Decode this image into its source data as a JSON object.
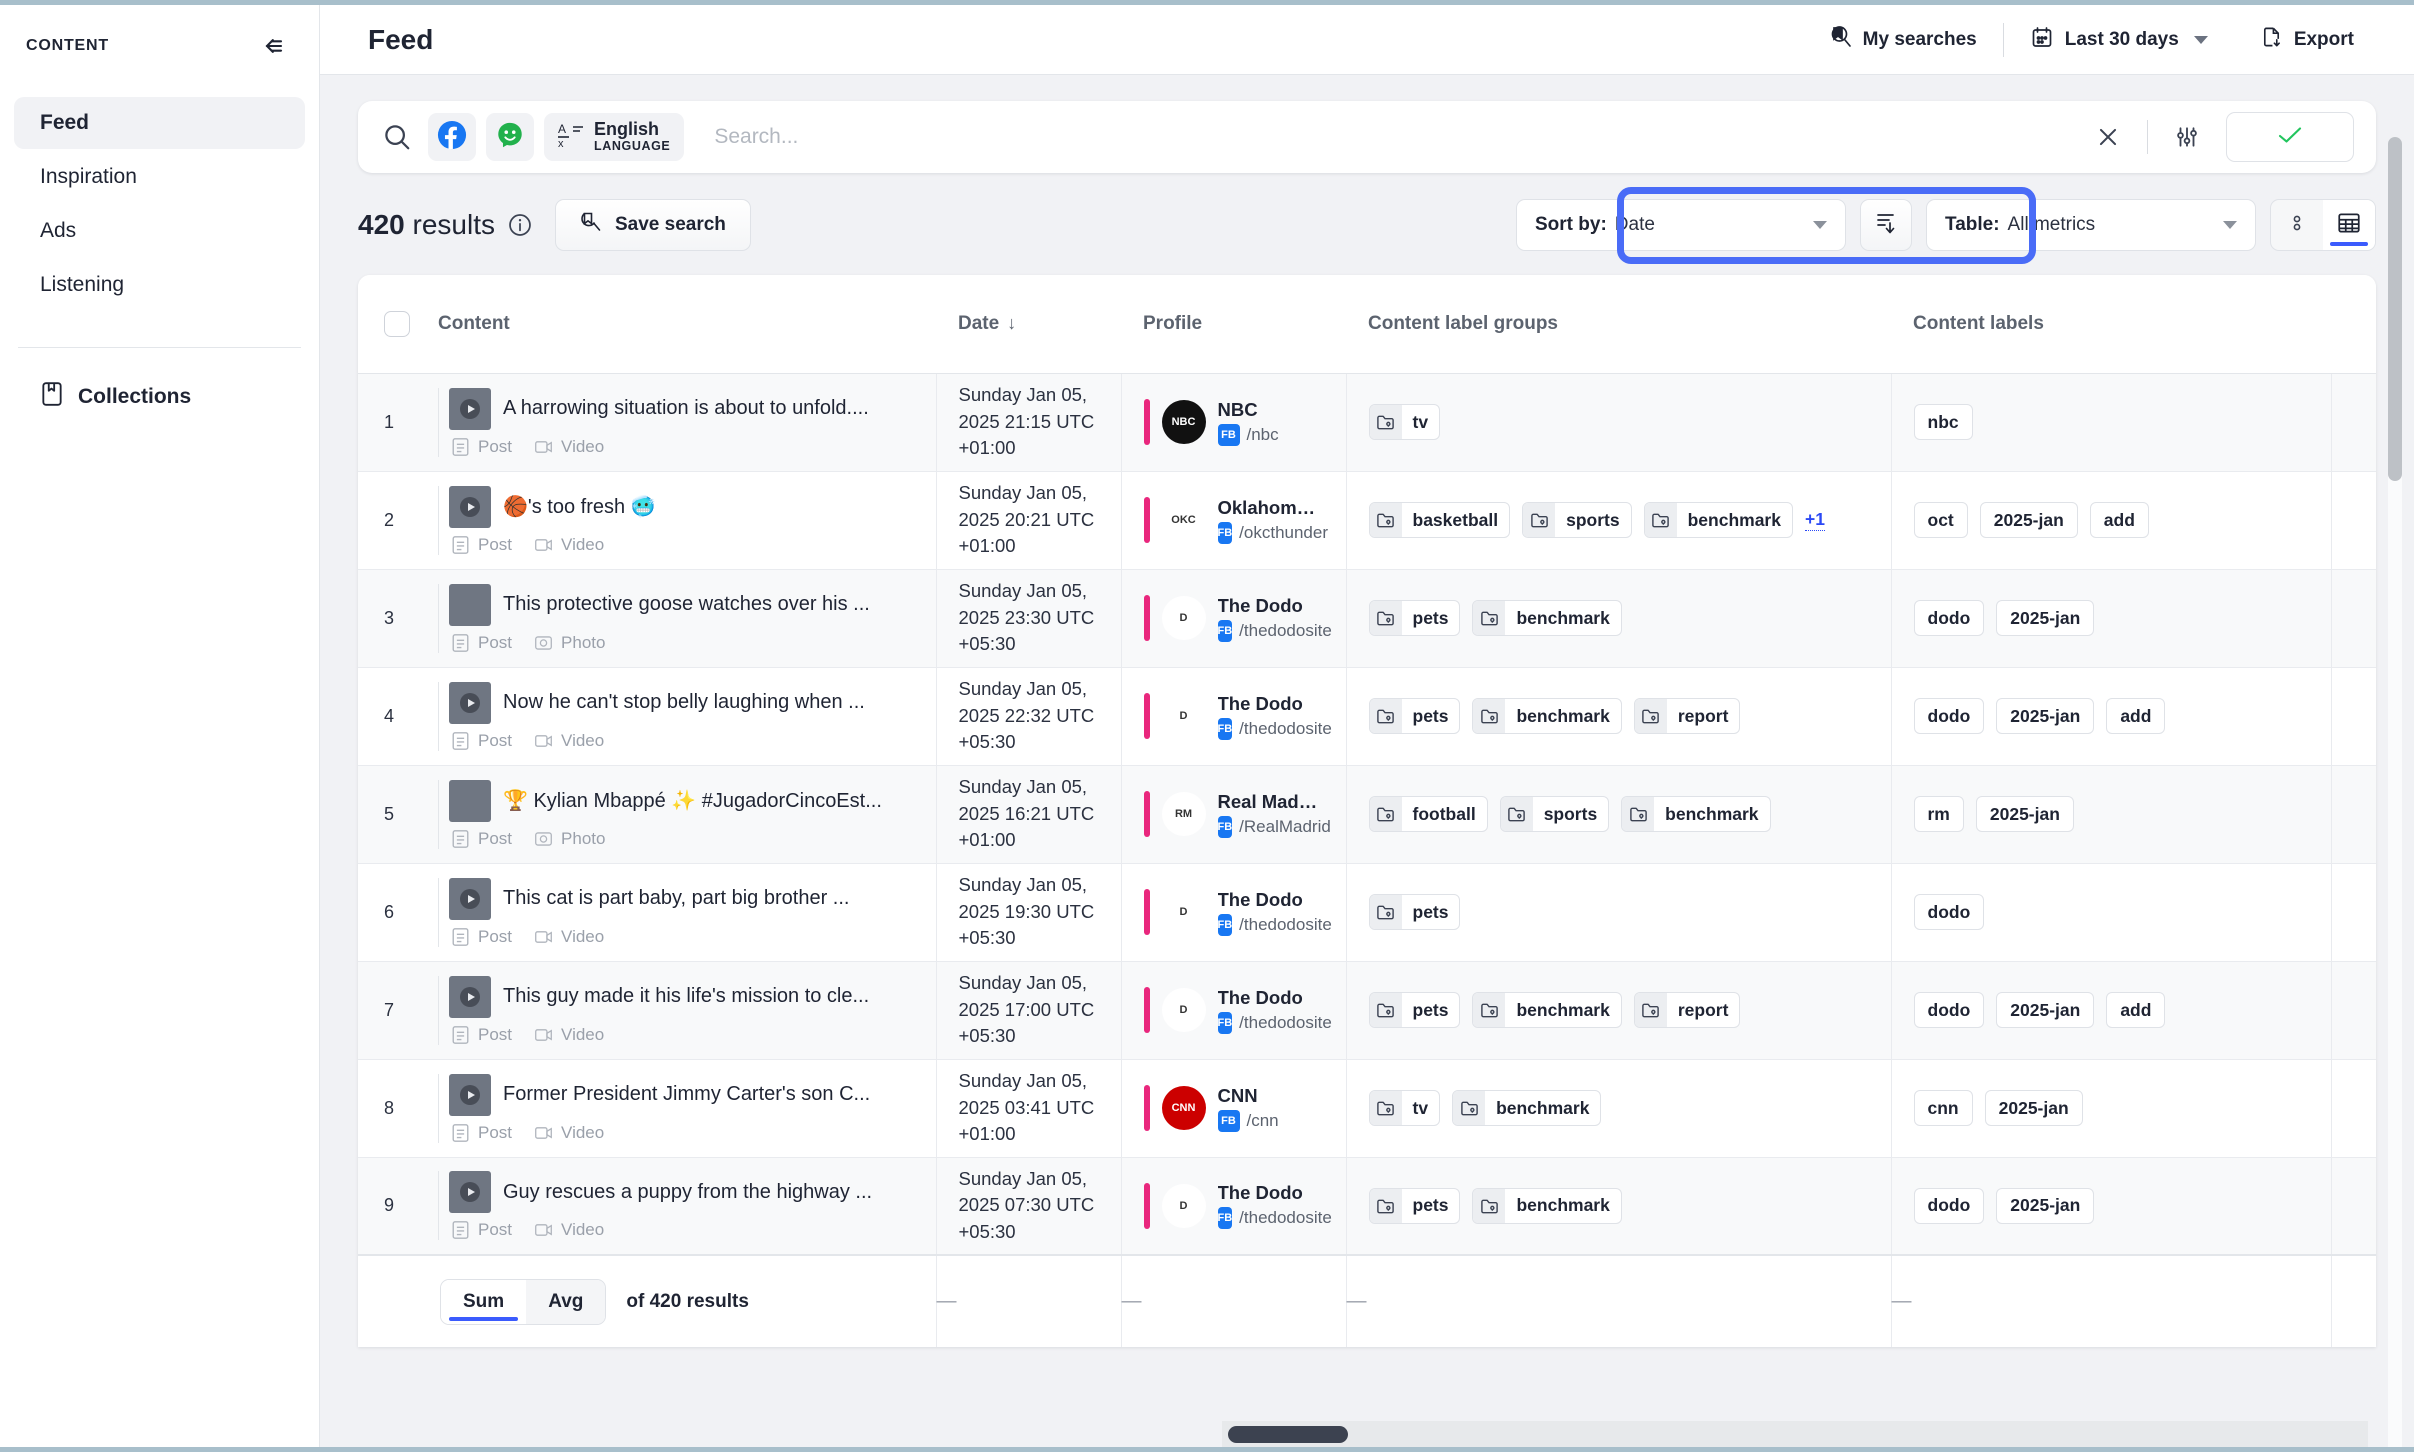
{
  "sidebar": {
    "title": "CONTENT",
    "collapse_icon": "collapse-panel-icon",
    "items": [
      {
        "label": "Feed",
        "active": true
      },
      {
        "label": "Inspiration",
        "active": false
      },
      {
        "label": "Ads",
        "active": false
      },
      {
        "label": "Listening",
        "active": false
      }
    ],
    "collections": {
      "label": "Collections",
      "icon": "bookmark-book-icon"
    }
  },
  "header": {
    "title": "Feed",
    "my_searches": "My searches",
    "date_range": "Last 30 days",
    "export": "Export"
  },
  "search": {
    "placeholder": "Search...",
    "value": "",
    "network_chip": "facebook-icon",
    "sentiment_chip": "sentiment-smiley-icon",
    "language_name": "English",
    "language_sub": "LANGUAGE",
    "clear_icon": "close-icon",
    "filters_icon": "sliders-icon",
    "submit_icon": "check-icon",
    "submit_color": "#22c55e"
  },
  "results": {
    "count": "420",
    "count_suffix": " results",
    "info_icon": "info-icon",
    "save_search": "Save search",
    "sort_label": "Sort by:",
    "sort_value": "Date",
    "sort_direction_icon": "sort-descending-icon",
    "table_label": "Table:",
    "table_value": "All metrics",
    "more_icon": "more-options-icon",
    "table_view_icon": "table-view-icon",
    "accent": "#3b5bfd"
  },
  "table": {
    "columns": [
      "Content",
      "Date",
      "Profile",
      "Content label groups",
      "Content labels"
    ],
    "sorted_column": "Date",
    "sort_arrow": "↓",
    "rows": [
      {
        "index": "1",
        "text": "A harrowing situation is about to unfold....",
        "kind": "Post",
        "media": "Video",
        "date": "Sunday Jan 05, 2025 21:15 UTC +01:00",
        "profile_name": "NBC",
        "profile_handle": "/nbc",
        "network": "FB",
        "avatar_color": "#111111",
        "avatar_text": "NBC",
        "label_groups": [
          "tv"
        ],
        "extra_groups": "",
        "labels": [
          "nbc"
        ]
      },
      {
        "index": "2",
        "text": "🏀's too fresh 🥶",
        "kind": "Post",
        "media": "Video",
        "date": "Sunday Jan 05, 2025 20:21 UTC +01:00",
        "profile_name": "Oklahoma City Th...",
        "profile_handle": "/okcthunder",
        "network": "FB",
        "avatar_color": "#ffffff",
        "avatar_text": "OKC",
        "label_groups": [
          "basketball",
          "sports",
          "benchmark"
        ],
        "extra_groups": "+1",
        "labels": [
          "oct",
          "2025-jan",
          "add"
        ]
      },
      {
        "index": "3",
        "text": "This protective goose watches over his ...",
        "kind": "Post",
        "media": "Photo",
        "date": "Sunday Jan 05, 2025 23:30 UTC +05:30",
        "profile_name": "The Dodo",
        "profile_handle": "/thedodosite",
        "network": "FB",
        "avatar_color": "#ffffff",
        "avatar_text": "D",
        "label_groups": [
          "pets",
          "benchmark"
        ],
        "extra_groups": "",
        "labels": [
          "dodo",
          "2025-jan"
        ]
      },
      {
        "index": "4",
        "text": "Now he can't stop belly laughing when ...",
        "kind": "Post",
        "media": "Video",
        "date": "Sunday Jan 05, 2025 22:32 UTC +05:30",
        "profile_name": "The Dodo",
        "profile_handle": "/thedodosite",
        "network": "FB",
        "avatar_color": "#ffffff",
        "avatar_text": "D",
        "label_groups": [
          "pets",
          "benchmark",
          "report"
        ],
        "extra_groups": "",
        "labels": [
          "dodo",
          "2025-jan",
          "add"
        ]
      },
      {
        "index": "5",
        "text": "🏆 Kylian Mbappé ✨ #JugadorCincoEst...",
        "kind": "Post",
        "media": "Photo",
        "date": "Sunday Jan 05, 2025 16:21 UTC +01:00",
        "profile_name": "Real Madrid C.F.",
        "profile_handle": "/RealMadrid",
        "network": "FB",
        "avatar_color": "#ffffff",
        "avatar_text": "RM",
        "label_groups": [
          "football",
          "sports",
          "benchmark"
        ],
        "extra_groups": "",
        "labels": [
          "rm",
          "2025-jan"
        ]
      },
      {
        "index": "6",
        "text": "This cat is part baby, part big brother ...",
        "kind": "Post",
        "media": "Video",
        "date": "Sunday Jan 05, 2025 19:30 UTC +05:30",
        "profile_name": "The Dodo",
        "profile_handle": "/thedodosite",
        "network": "FB",
        "avatar_color": "#ffffff",
        "avatar_text": "D",
        "label_groups": [
          "pets"
        ],
        "extra_groups": "",
        "labels": [
          "dodo"
        ]
      },
      {
        "index": "7",
        "text": "This guy made it his life's mission to cle...",
        "kind": "Post",
        "media": "Video",
        "date": "Sunday Jan 05, 2025 17:00 UTC +05:30",
        "profile_name": "The Dodo",
        "profile_handle": "/thedodosite",
        "network": "FB",
        "avatar_color": "#ffffff",
        "avatar_text": "D",
        "label_groups": [
          "pets",
          "benchmark",
          "report"
        ],
        "extra_groups": "",
        "labels": [
          "dodo",
          "2025-jan",
          "add"
        ]
      },
      {
        "index": "8",
        "text": "Former President Jimmy Carter's son C...",
        "kind": "Post",
        "media": "Video",
        "date": "Sunday Jan 05, 2025 03:41 UTC +01:00",
        "profile_name": "CNN",
        "profile_handle": "/cnn",
        "network": "FB",
        "avatar_color": "#cc0000",
        "avatar_text": "CNN",
        "label_groups": [
          "tv",
          "benchmark"
        ],
        "extra_groups": "",
        "labels": [
          "cnn",
          "2025-jan"
        ]
      },
      {
        "index": "9",
        "text": "Guy rescues a puppy from the highway ...",
        "kind": "Post",
        "media": "Video",
        "date": "Sunday Jan 05, 2025 07:30 UTC +05:30",
        "profile_name": "The Dodo",
        "profile_handle": "/thedodosite",
        "network": "FB",
        "avatar_color": "#ffffff",
        "avatar_text": "D",
        "label_groups": [
          "pets",
          "benchmark"
        ],
        "extra_groups": "",
        "labels": [
          "dodo",
          "2025-jan"
        ]
      }
    ],
    "summary": {
      "sum_label": "Sum",
      "avg_label": "Avg",
      "active": "Sum",
      "of_results": "of 420 results",
      "empty_value": "—"
    }
  }
}
